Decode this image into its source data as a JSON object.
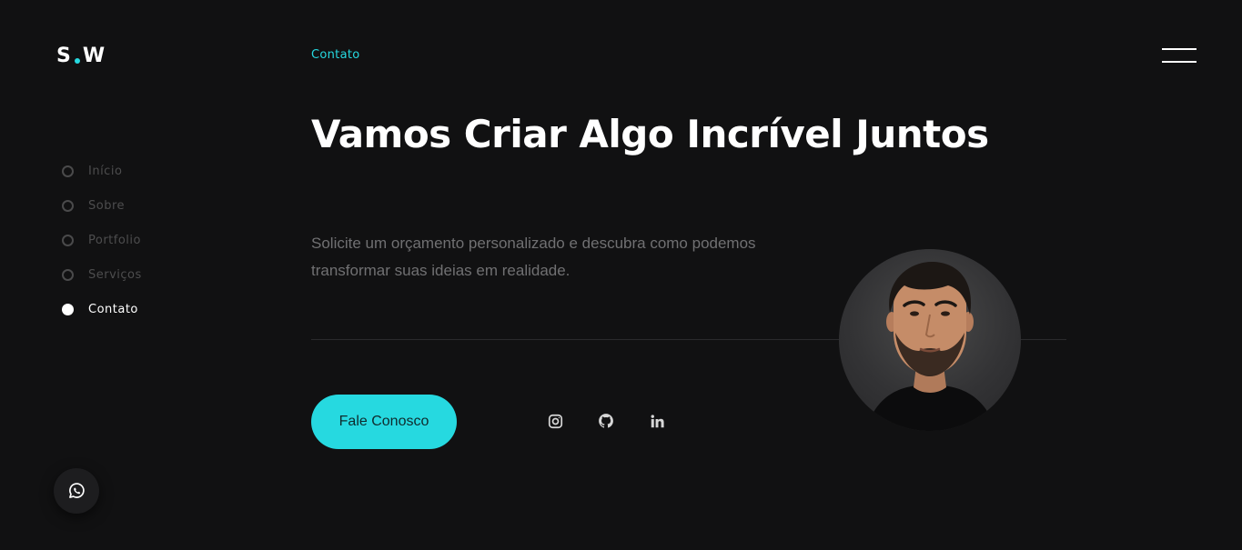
{
  "brand": {
    "logo_left": "S",
    "logo_right": "W"
  },
  "header": {
    "section_label": "Contato"
  },
  "nav": {
    "items": [
      {
        "label": "Início",
        "active": false
      },
      {
        "label": "Sobre",
        "active": false
      },
      {
        "label": "Portfolio",
        "active": false
      },
      {
        "label": "Serviços",
        "active": false
      },
      {
        "label": "Contato",
        "active": true
      }
    ]
  },
  "main": {
    "headline": "Vamos Criar Algo Incrível Juntos",
    "description": "Solicite um orçamento personalizado e descubra como podemos transformar suas ideias em realidade.",
    "cta_label": "Fale Conosco"
  },
  "socials": [
    "instagram-icon",
    "github-icon",
    "linkedin-icon"
  ],
  "icons": {
    "menu": "menu-icon",
    "whatsapp": "whatsapp-icon"
  },
  "colors": {
    "background": "#111112",
    "accent": "#26d9e0",
    "text_primary": "#ffffff",
    "text_muted": "#707072",
    "nav_inactive": "#4d4d4e"
  }
}
